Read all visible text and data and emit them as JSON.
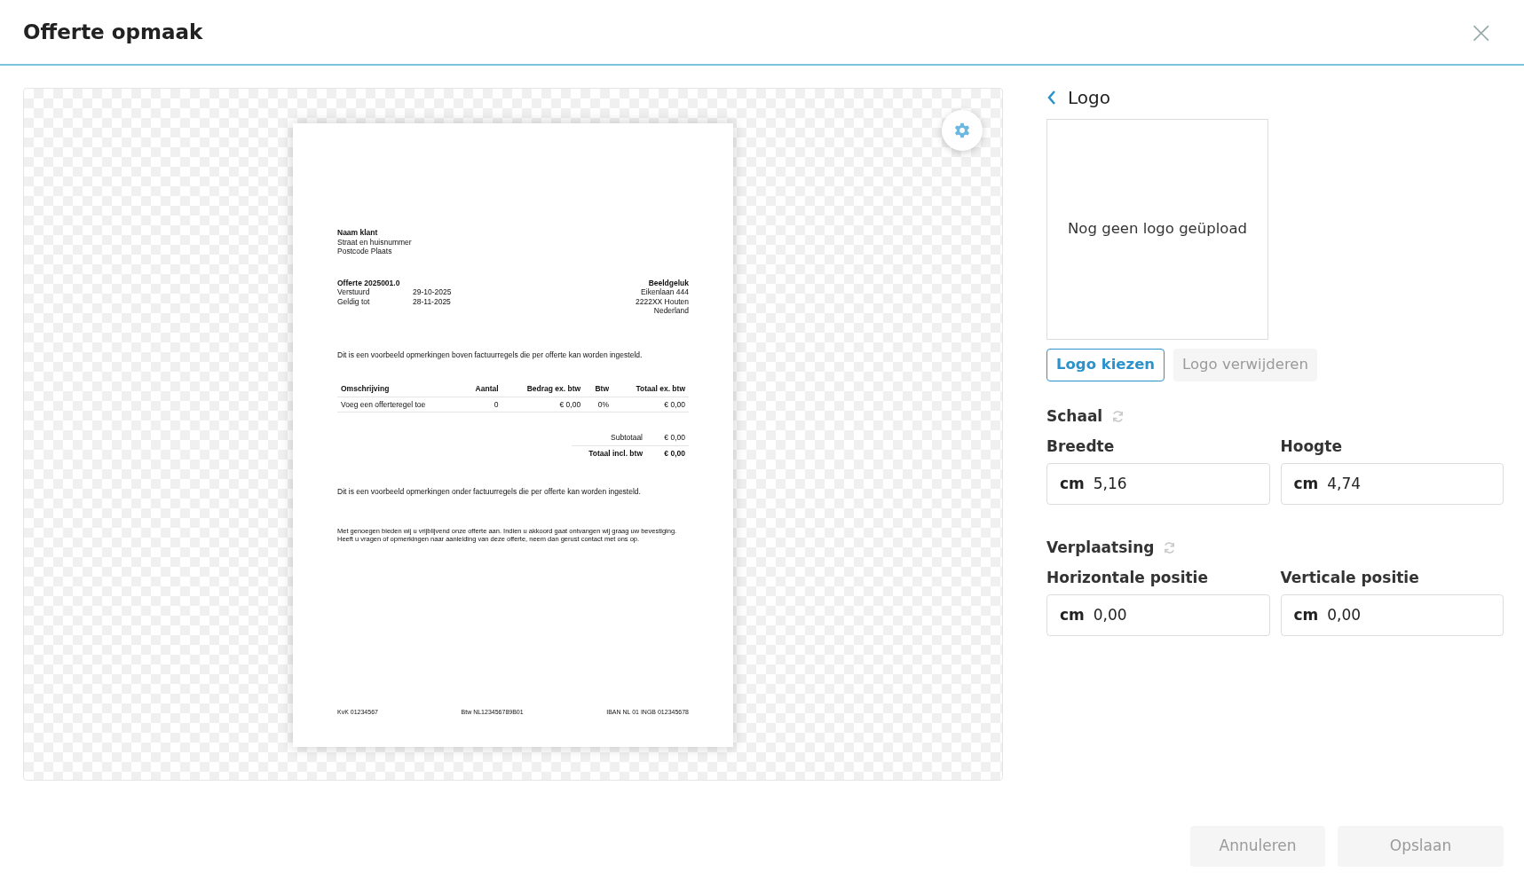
{
  "dialog": {
    "title": "Offerte opmaak",
    "close_label": "×"
  },
  "document": {
    "client": {
      "name": "Naam klant",
      "lines": [
        "Straat en huisnummer",
        "Postcode Plaats"
      ]
    },
    "quote": {
      "title": "Offerte 2025001.0",
      "fields": [
        {
          "label": "Verstuurd",
          "value": "29-10-2025"
        },
        {
          "label": "Geldig tot",
          "value": "28-11-2025"
        }
      ]
    },
    "company": {
      "name": "Beeldgeluk",
      "lines": [
        "Eikenlaan 444",
        "2222XX Houten",
        "Nederland"
      ]
    },
    "remark_above": "Dit is een voorbeeld opmerkingen boven factuurregels die per offerte kan worden ingesteld.",
    "table": {
      "columns": [
        "Omschrijving",
        "Aantal",
        "Bedrag ex. btw",
        "Btw",
        "Totaal ex. btw"
      ],
      "rows": [
        [
          "Voeg een offerteregel toe",
          "0",
          "€ 0,00",
          "0%",
          "€ 0,00"
        ]
      ]
    },
    "totals": [
      {
        "label": "Subtotaal",
        "value": "€ 0,00",
        "bold": false
      },
      {
        "label": "Totaal incl. btw",
        "value": "€ 0,00",
        "bold": true
      }
    ],
    "remark_below": "Dit is een voorbeeld opmerkingen onder factuurregels die per offerte kan worden ingesteld.",
    "closing": "Met genoegen bieden wij u vrijblijvend onze offerte aan. Indien u akkoord gaat ontvangen wij graag uw bevestiging. Heeft u vragen of opmerkingen naar aanleiding van deze offerte, neem dan gerust contact met ons op.",
    "footer": [
      "KvK 01234567",
      "Btw NL123456789B01",
      "IBAN NL 01 INGB 012345678"
    ]
  },
  "panel": {
    "title": "Logo",
    "logo_placeholder": "Nog geen logo geüpload",
    "logo_buttons": [
      {
        "label": "Logo kiezen",
        "disabled": false
      },
      {
        "label": "Logo verwijderen",
        "disabled": true
      }
    ],
    "sections": [
      {
        "title": "Schaal",
        "fields": [
          {
            "label": "Breedte",
            "unit": "cm",
            "value": "5,16"
          },
          {
            "label": "Hoogte",
            "unit": "cm",
            "value": "4,74"
          }
        ]
      },
      {
        "title": "Verplaatsing",
        "fields": [
          {
            "label": "Horizontale positie",
            "unit": "cm",
            "value": "0,00"
          },
          {
            "label": "Verticale positie",
            "unit": "cm",
            "value": "0,00"
          }
        ]
      }
    ]
  },
  "footer_buttons": [
    {
      "label": "Annuleren",
      "disabled": true
    },
    {
      "label": "Opslaan",
      "disabled": true
    }
  ]
}
